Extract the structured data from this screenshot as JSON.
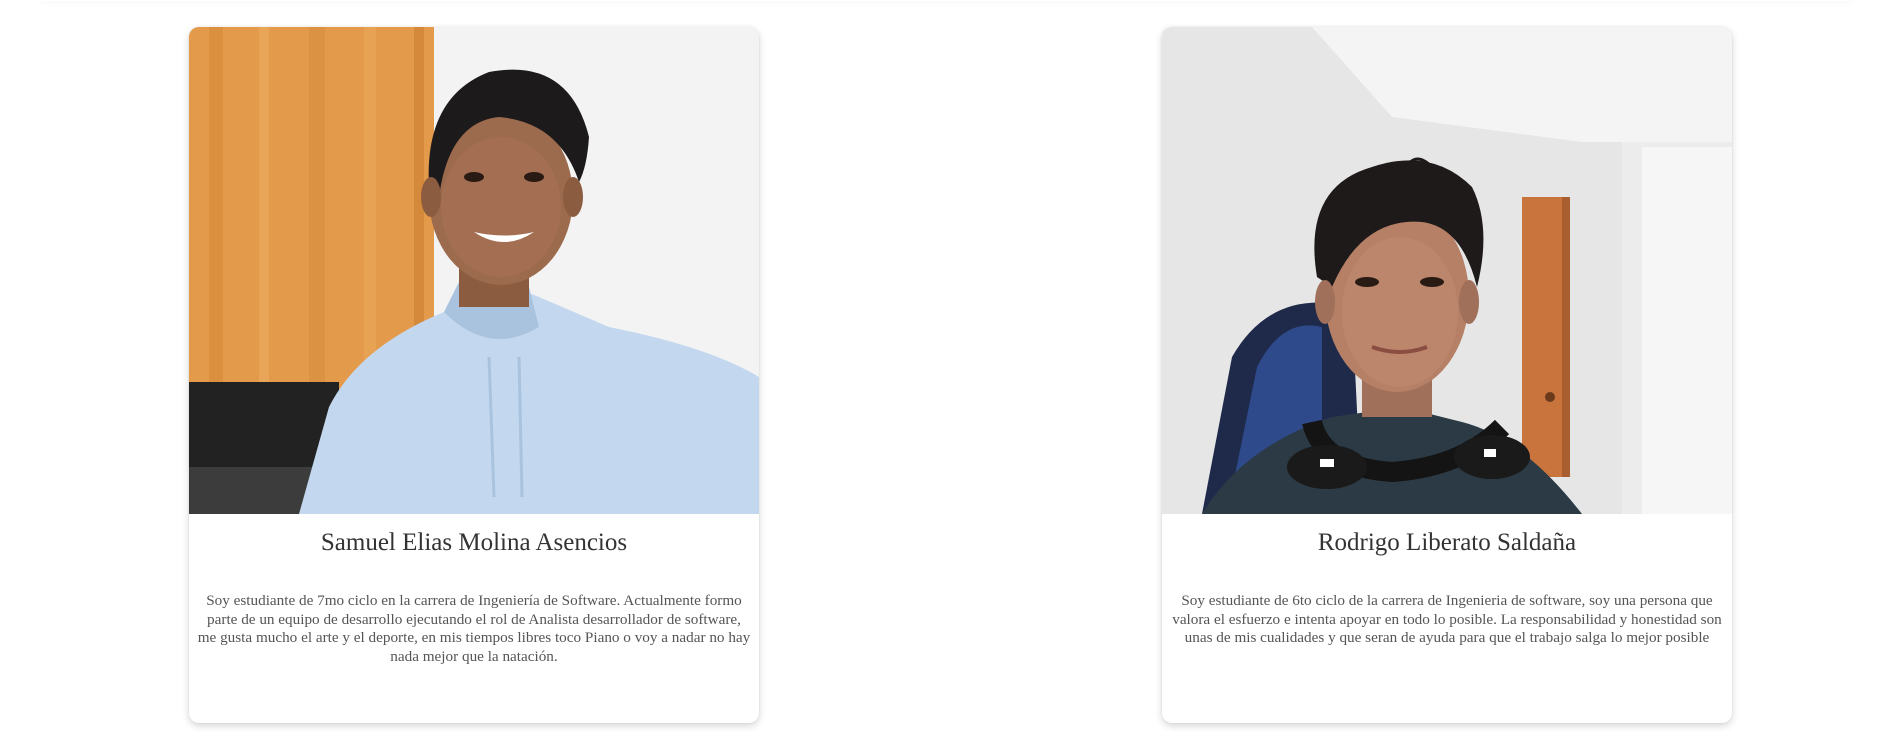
{
  "team": {
    "members": [
      {
        "name": "Samuel Elias Molina Asencios",
        "description": "Soy estudiante de 7mo ciclo en la carrera de Ingeniería de Software. Actualmente formo parte de un equipo de desarrollo ejecutando el rol de Analista desarrollador de software, me gusta mucho el arte y el deporte, en mis tiempos libres toco Piano o voy a nadar no hay nada mejor que la natación.",
        "photo_alt": "photo",
        "photo_icon": "person-photo",
        "colors": {
          "background_wall": "#f1f1f1",
          "curtain": "#e39a4a",
          "hoodie": "#c3d8ef",
          "skin": "#9c6a4c",
          "hair": "#1d1a1c"
        }
      },
      {
        "name": "Rodrigo Liberato Saldaña",
        "description": "Soy estudiante de 6to ciclo de la carrera de Ingenieria de software, soy una persona que valora el esfuerzo e intenta apoyar en todo lo posible. La responsabilidad y honestidad son unas de mis cualidades y que seran de ayuda para que el trabajo salga lo mejor posible",
        "photo_alt": "photo",
        "photo_icon": "person-photo",
        "colors": {
          "background_wall": "#e9e9e9",
          "door": "#c8743c",
          "shirt": "#2b3a44",
          "skin": "#b58066",
          "hair": "#1e1a1a"
        }
      }
    ]
  }
}
